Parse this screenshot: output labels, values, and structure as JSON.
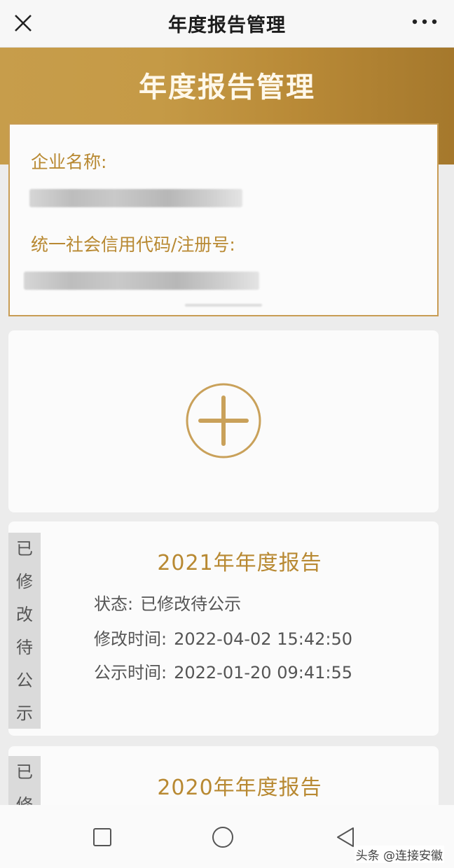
{
  "topbar": {
    "title": "年度报告管理",
    "close_icon": "close-icon",
    "more_icon": "more-icon"
  },
  "header": {
    "title": "年度报告管理"
  },
  "enterprise": {
    "name_label": "企业名称:",
    "code_label": "统一社会信用代码/注册号:"
  },
  "add": {
    "icon": "plus-circle-icon"
  },
  "reports": [
    {
      "status_tag": [
        "已",
        "修",
        "改",
        "待",
        "公",
        "示"
      ],
      "title": "2021年年度报告",
      "status_label": "状态:",
      "status_value": "已修改待公示",
      "modified_label": "修改时间:",
      "modified_value": "2022-04-02 15:42:50",
      "published_label": "公示时间:",
      "published_value": "2022-01-20 09:41:55"
    },
    {
      "status_tag": [
        "已",
        "修"
      ],
      "title": "2020年年度报告"
    }
  ],
  "sysnav": {
    "recent_icon": "square-icon",
    "home_icon": "circle-icon",
    "back_icon": "triangle-back-icon"
  },
  "watermark": "头条 @连接安徽",
  "colors": {
    "gold": "#c59a46",
    "gold_text": "#b88932",
    "background": "#ececec"
  }
}
